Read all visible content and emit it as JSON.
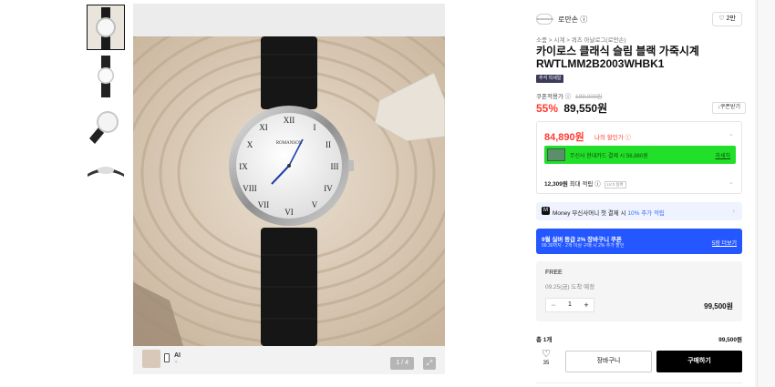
{
  "product": {
    "brand": "로만손",
    "brand_logo_text": "ROMANSON",
    "likes": "2만",
    "breadcrumb": "소품 > 시계 > 쿼츠 아날로그(로만손)",
    "title": "카이로스 클래식 슬림 블랙 가죽시계 RWTLMM2B2003WHBK1",
    "tag": "추석 빅세일",
    "watch_logo": "ROMANSON"
  },
  "gallery": {
    "pager": "1 / 4",
    "ai_label": "AI",
    "ai_sub": "✧"
  },
  "pricing": {
    "coupon_label": "쿠폰적용가",
    "original": "199,000원",
    "sale_percent": "55%",
    "sale_price": "89,550원",
    "coupon_button": "↓쿠폰받기",
    "my_price": "84,890원",
    "my_price_label": "나의 할인가",
    "card_text": "무신사 현대카드 결제 시 56,880원",
    "card_more": "자세히",
    "points": "12,309원",
    "points_label": "최대 적립",
    "level_badge": "LV.3 실버",
    "money_prefix": "Money 무신사머니 첫 결제 시",
    "money_highlight": "10% 추가 적립",
    "banner_title": "9월 실버 등급 2% 장바구니 쿠폰",
    "banner_sub": "09.30까지 · 2개 이상 구매 시 2% 추가 할인",
    "banner_more": "5장 더보기"
  },
  "option": {
    "shipping": "FREE",
    "delivery": "09.25(금) 도착 예정",
    "minus": "−",
    "plus": "+",
    "quantity": "1",
    "price": "99,500원"
  },
  "summary": {
    "total_label": "총 1개",
    "total_value": "99,500원",
    "heart_glyph": "♡",
    "heart_count": "35",
    "cart": "장바구니",
    "buy": "구매하기"
  },
  "icons": {
    "like_glyph": "♡",
    "info_glyph": "ⓘ",
    "chevron": "⌄",
    "chevron_right": "›",
    "expand_glyph": "⤢",
    "money_glyph": "M"
  },
  "colors": {
    "sale_red": "#ff3b30",
    "card_green": "#22e02a",
    "banner_blue": "#2457ff",
    "money_accent": "#3b6bff"
  }
}
